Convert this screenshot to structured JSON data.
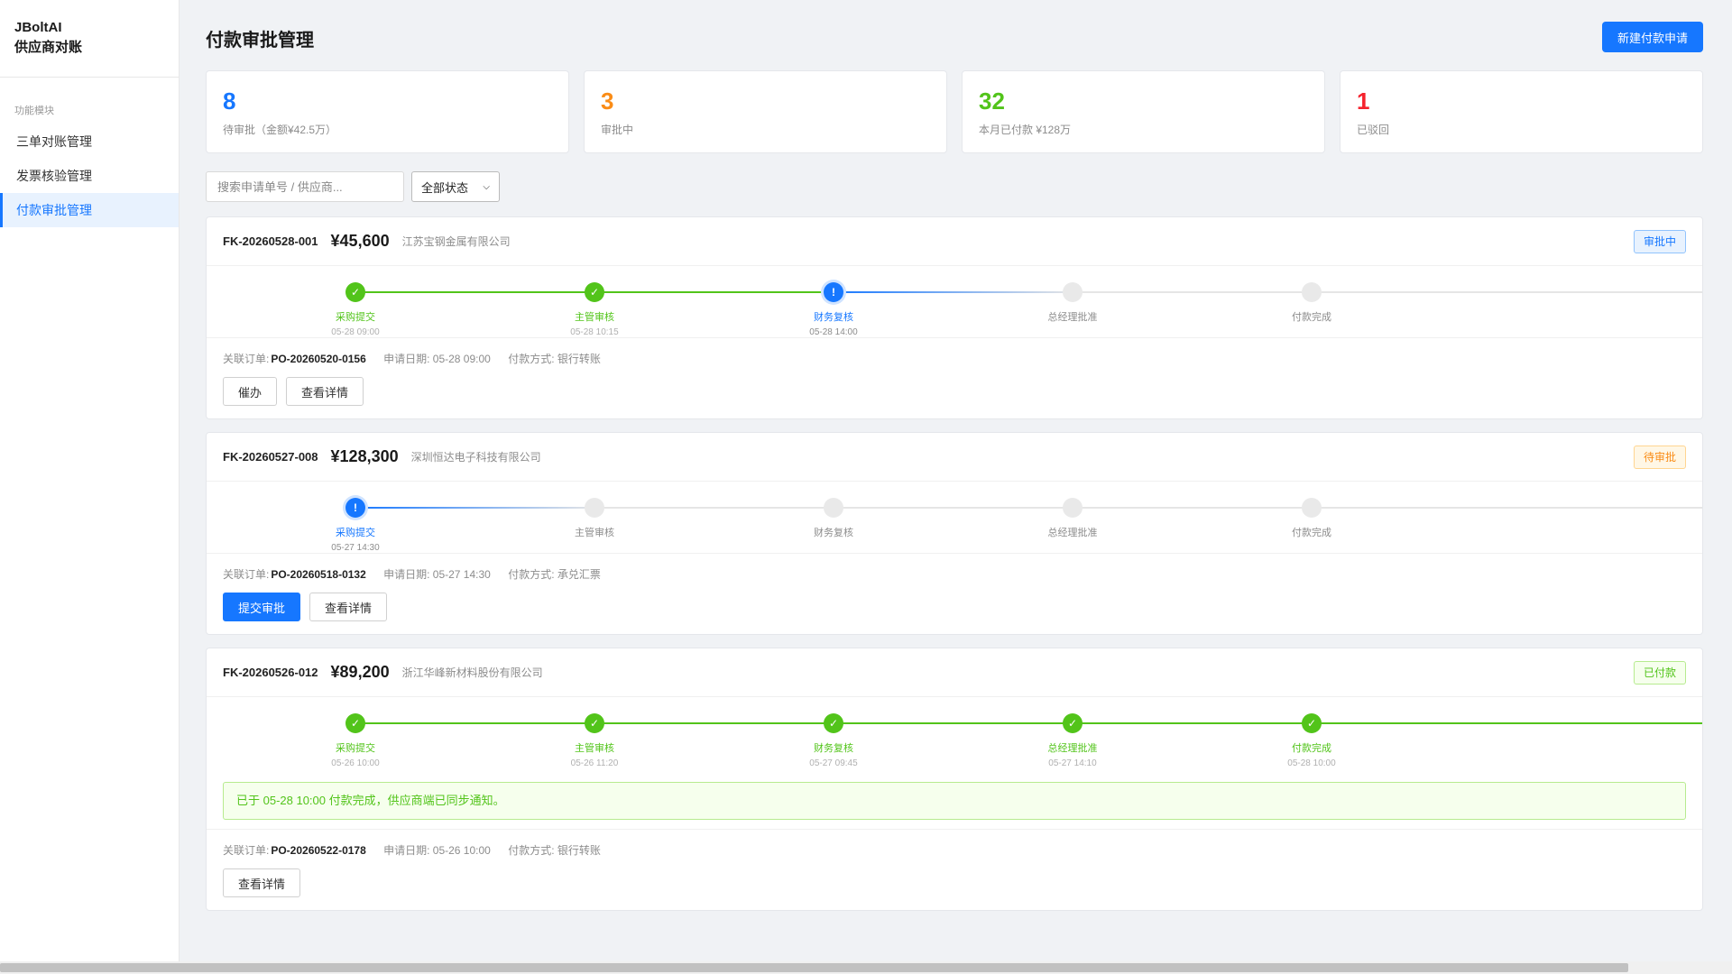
{
  "sidebar": {
    "brand_line1": "JBoltAI",
    "brand_line2": "供应商对账",
    "group_title": "功能模块",
    "items": [
      {
        "label": "三单对账管理",
        "active": false
      },
      {
        "label": "发票核验管理",
        "active": false
      },
      {
        "label": "付款审批管理",
        "active": true
      }
    ]
  },
  "header": {
    "title": "付款审批管理",
    "new_button": "新建付款申请"
  },
  "stats": [
    {
      "value": "8",
      "label": "待审批（金额¥42.5万）",
      "color": "#1677ff"
    },
    {
      "value": "3",
      "label": "审批中",
      "color": "#fa8c16"
    },
    {
      "value": "32",
      "label": "本月已付款 ¥128万",
      "color": "#52c41a"
    },
    {
      "value": "1",
      "label": "已驳回",
      "color": "#f5222d"
    }
  ],
  "filters": {
    "search_placeholder": "搜索申请单号 / 供应商...",
    "status_selected": "全部状态"
  },
  "cards": [
    {
      "id": "FK-20260528-001",
      "amount": "¥45,600",
      "supplier": "江苏宝钢金属有限公司",
      "badge": "审批中",
      "steps": [
        {
          "name": "采购提交",
          "time": "05-28 09:00",
          "state": "done"
        },
        {
          "name": "主管审核",
          "time": "05-28 10:15",
          "state": "done"
        },
        {
          "name": "财务复核",
          "time": "05-28 14:00",
          "state": "current"
        },
        {
          "name": "总经理批准",
          "time": "",
          "state": "pending"
        },
        {
          "name": "付款完成",
          "time": "",
          "state": "pending"
        }
      ],
      "order_label": "关联订单:",
      "order": "PO-20260520-0156",
      "apply_date": "申请日期: 05-28 09:00",
      "pay_method": "付款方式: 银行转账",
      "actions": [
        "催办",
        "查看详情"
      ]
    },
    {
      "id": "FK-20260527-008",
      "amount": "¥128,300",
      "supplier": "深圳恒达电子科技有限公司",
      "badge": "待审批",
      "steps": [
        {
          "name": "采购提交",
          "time": "05-27 14:30",
          "state": "current"
        },
        {
          "name": "主管审核",
          "time": "",
          "state": "pending"
        },
        {
          "name": "财务复核",
          "time": "",
          "state": "pending"
        },
        {
          "name": "总经理批准",
          "time": "",
          "state": "pending"
        },
        {
          "name": "付款完成",
          "time": "",
          "state": "pending"
        }
      ],
      "order_label": "关联订单:",
      "order": "PO-20260518-0132",
      "apply_date": "申请日期: 05-27 14:30",
      "pay_method": "付款方式: 承兑汇票",
      "actions": [
        "提交审批",
        "查看详情"
      ]
    },
    {
      "id": "FK-20260526-012",
      "amount": "¥89,200",
      "supplier": "浙江华峰新材料股份有限公司",
      "badge": "已付款",
      "steps": [
        {
          "name": "采购提交",
          "time": "05-26 10:00",
          "state": "done"
        },
        {
          "name": "主管审核",
          "time": "05-26 11:20",
          "state": "done"
        },
        {
          "name": "财务复核",
          "time": "05-27 09:45",
          "state": "done"
        },
        {
          "name": "总经理批准",
          "time": "05-27 14:10",
          "state": "done"
        },
        {
          "name": "付款完成",
          "time": "05-28 10:00",
          "state": "done"
        }
      ],
      "notice": "已于 05-28 10:00 付款完成，供应商端已同步通知。",
      "order_label": "关联订单:",
      "order": "PO-20260522-0178",
      "apply_date": "申请日期: 05-26 10:00",
      "pay_method": "付款方式: 银行转账",
      "actions": [
        "查看详情"
      ]
    }
  ],
  "icons": {
    "check": "check-icon",
    "pending": "exclamation-icon"
  }
}
